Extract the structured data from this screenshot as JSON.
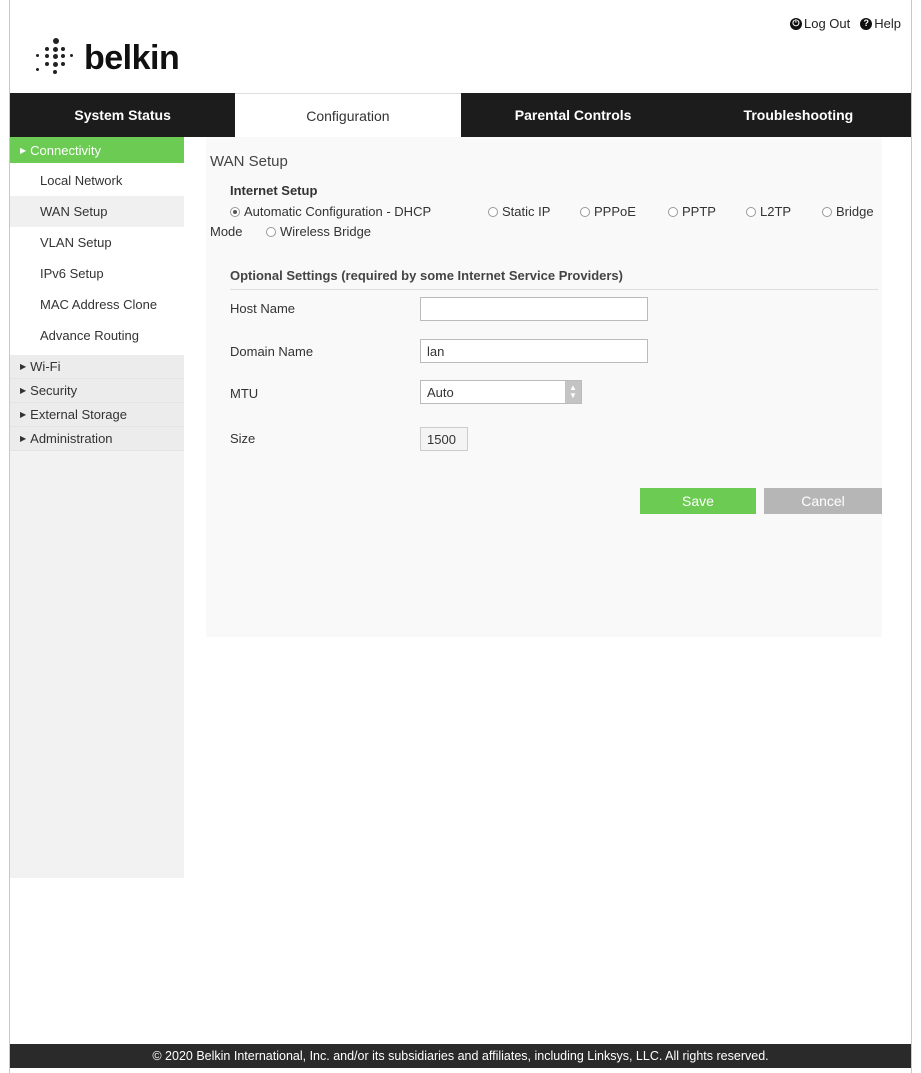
{
  "brand": {
    "logo_text": "belkin"
  },
  "header_links": {
    "logout_label": "Log Out",
    "help_label": "Help"
  },
  "tabs": [
    {
      "label": "System Status"
    },
    {
      "label": "Configuration"
    },
    {
      "label": "Parental Controls"
    },
    {
      "label": "Troubleshooting"
    }
  ],
  "sidebar": {
    "connectivity": {
      "label": "Connectivity",
      "items": [
        {
          "label": "Local Network"
        },
        {
          "label": "WAN Setup"
        },
        {
          "label": "VLAN Setup"
        },
        {
          "label": "IPv6 Setup"
        },
        {
          "label": "MAC Address Clone"
        },
        {
          "label": "Advance Routing"
        }
      ]
    },
    "sections": [
      {
        "label": "Wi-Fi"
      },
      {
        "label": "Security"
      },
      {
        "label": "External Storage"
      },
      {
        "label": "Administration"
      }
    ]
  },
  "main": {
    "title": "WAN Setup",
    "internet_setup": {
      "label": "Internet Setup",
      "options": [
        {
          "label": "Automatic Configuration - DHCP"
        },
        {
          "label": "Static IP"
        },
        {
          "label": "PPPoE"
        },
        {
          "label": "PPTP"
        },
        {
          "label": "L2TP"
        },
        {
          "label": "Bridge"
        },
        {
          "label": "Mode"
        },
        {
          "label": "Wireless Bridge"
        }
      ],
      "selected": "Automatic Configuration - DHCP"
    },
    "optional": {
      "title": "Optional Settings (required by some Internet Service Providers)",
      "host_name": {
        "label": "Host Name",
        "value": ""
      },
      "domain_name": {
        "label": "Domain Name",
        "value": "lan"
      },
      "mtu": {
        "label": "MTU",
        "value": "Auto"
      },
      "size": {
        "label": "Size",
        "value": "1500"
      }
    },
    "buttons": {
      "save": "Save",
      "cancel": "Cancel"
    }
  },
  "footer": {
    "text": "© 2020 Belkin International, Inc. and/or its subsidiaries and affiliates, including Linksys, LLC. All rights reserved."
  },
  "colors": {
    "accent_green": "#6ccb52",
    "nav_dark": "#1c1c1c",
    "cancel_gray": "#b6b6b6"
  }
}
